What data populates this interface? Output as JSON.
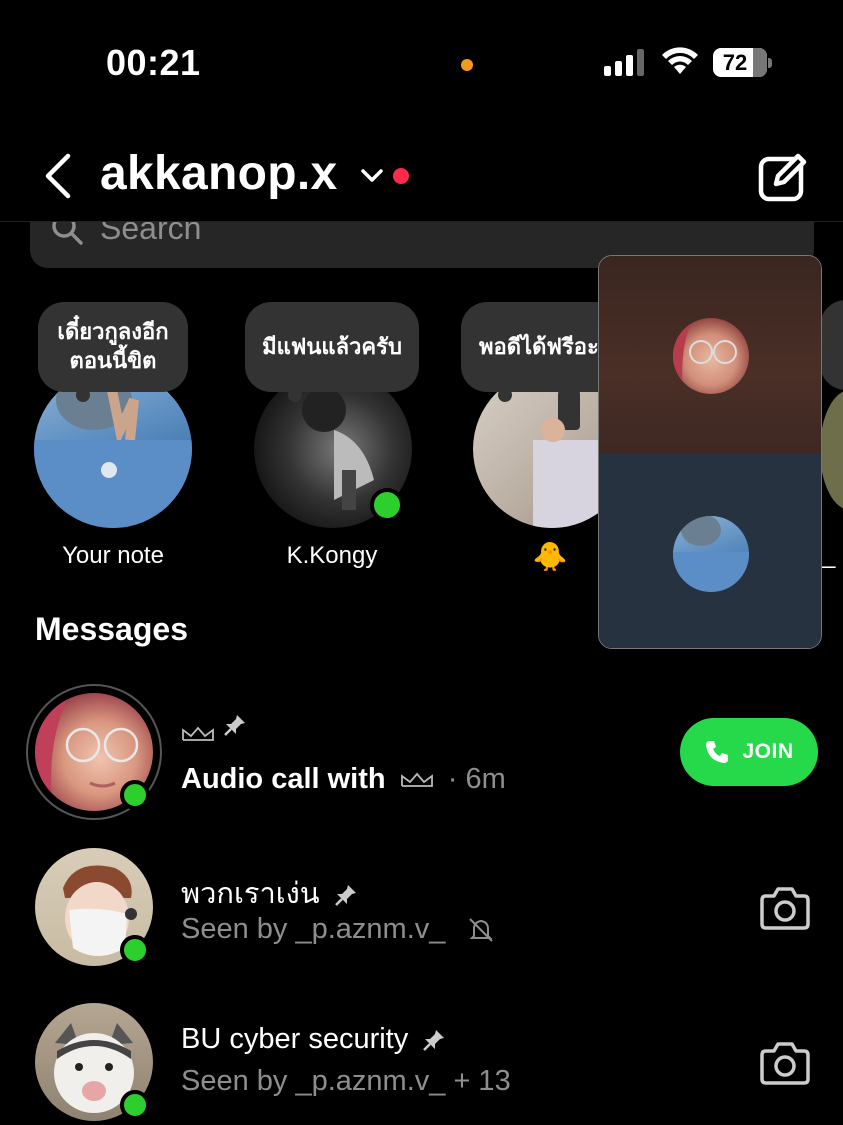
{
  "status_bar": {
    "time": "00:21",
    "battery": "72",
    "icons": [
      "orange-dot-indicator",
      "signal-icon",
      "wifi-icon",
      "battery-icon"
    ]
  },
  "header": {
    "username": "akkanop.x",
    "icons": [
      "back-icon",
      "chevron-down-icon",
      "red-dot",
      "compose-icon"
    ]
  },
  "search": {
    "placeholder": "Search"
  },
  "notes": [
    {
      "bubble": "เดี๋ยวกูลงอีก ตอนนี้ขิต",
      "name": "Your note",
      "online": false
    },
    {
      "bubble": "มีแฟนแล้วครับ",
      "name": "K.Kongy",
      "online": true
    },
    {
      "bubble": "พอดีได้ฟรีอะ",
      "name": "🐥",
      "online": false
    }
  ],
  "call_panel": {
    "participants": 2
  },
  "messages": {
    "title": "Messages",
    "rows": [
      {
        "name": "",
        "subtitle": "Audio call with",
        "time": "· 6m",
        "action": "JOIN",
        "online": true,
        "pinned": true
      },
      {
        "name": "พวกเราเง่น",
        "subtitle": "Seen by _p.aznm.v_",
        "online": true,
        "pinned": true,
        "muted": true
      },
      {
        "name": "BU cyber security",
        "subtitle": "Seen by _p.aznm.v_ + 13",
        "online": true,
        "pinned": true
      }
    ]
  },
  "colors": {
    "background": "#000000",
    "online": "#2ccf2c",
    "join": "#25d94a",
    "notification": "#ff2a4c",
    "muted_text": "#8e8e8e"
  }
}
